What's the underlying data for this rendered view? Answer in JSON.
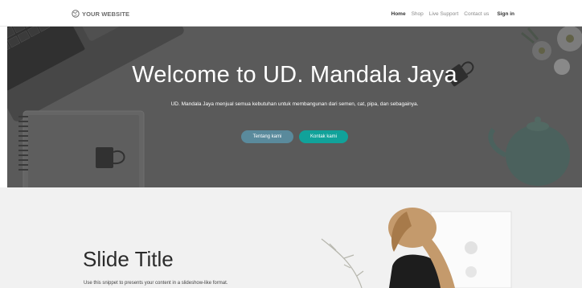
{
  "navbar": {
    "brand": "YOUR WEBSITE",
    "links": [
      {
        "label": "Home",
        "active": true
      },
      {
        "label": "Shop",
        "active": false
      },
      {
        "label": "Live Support",
        "active": false
      },
      {
        "label": "Contact us",
        "active": false
      },
      {
        "label": "Sign in",
        "active": false
      }
    ]
  },
  "hero": {
    "title": "Welcome to UD. Mandala Jaya",
    "subtitle": "UD. Mandala Jaya menjual semua kebutuhan untuk membangunan dari semen, cat, pipa, dan sebagainya.",
    "buttons": {
      "secondary": "Tentang kami",
      "primary": "Kontak kami"
    }
  },
  "slide": {
    "title": "Slide Title",
    "text": "Use this snippet to presents your content in a slideshow-like format."
  },
  "colors": {
    "accent": "#11a29a",
    "secondary": "#5a8a9c"
  },
  "icons": {
    "brand": "globe-icon"
  }
}
